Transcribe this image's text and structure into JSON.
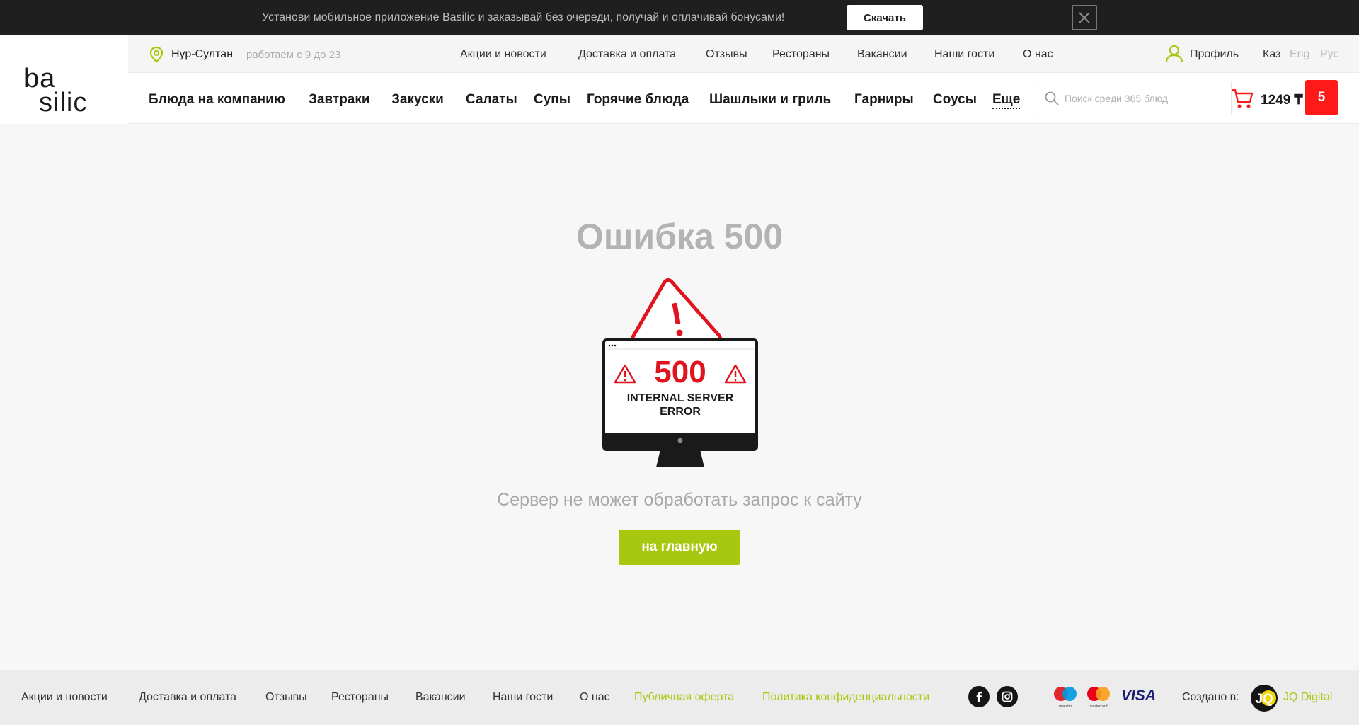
{
  "banner": {
    "text": "Установи мобильное приложение Basilic и заказывай без очереди, получай и оплачивай бонусами!",
    "download": "Скачать"
  },
  "logo": {
    "line1": "ba",
    "line2": "silic"
  },
  "topbar": {
    "city": "Нур-Султан",
    "hours": "работаем с 9 до 23",
    "nav": [
      "Акции и новости",
      "Доставка и оплата",
      "Отзывы",
      "Рестораны",
      "Вакансии",
      "Наши гости",
      "О нас"
    ],
    "profile": "Профиль",
    "langs": [
      "Каз",
      "Eng",
      "Рус"
    ]
  },
  "categories": [
    "Блюда на компанию",
    "Завтраки",
    "Закуски",
    "Салаты",
    "Супы",
    "Горячие блюда",
    "Шашлыки и гриль",
    "Гарниры",
    "Соусы",
    "Еще"
  ],
  "search": {
    "placeholder": "Поиск среди 365 блюд"
  },
  "cart": {
    "total": "1249 ₸",
    "count": "5"
  },
  "error": {
    "title": "Ошибка 500",
    "code": "500",
    "screen_line1": "INTERNAL SERVER",
    "screen_line2": "ERROR",
    "message": "Сервер не может обработать запрос к сайту",
    "button": "на главную"
  },
  "footer": {
    "nav": [
      "Акции и новости",
      "Доставка и оплата",
      "Отзывы",
      "Рестораны",
      "Вакансии",
      "Наши гости",
      "О нас"
    ],
    "offer": "Публичная оферта",
    "privacy": "Политика конфиденциальности",
    "maestro_label": "maestro",
    "mastercard_label": "mastercard",
    "visa": "VISA",
    "made_by": "Создано в:",
    "jq_mark": "JQ",
    "agency": "JQ Digital"
  },
  "colors": {
    "accent": "#a8c80f",
    "cart_badge": "#ff1a1a",
    "banner_bg": "#1f1f1f",
    "error_red": "#e0141e"
  },
  "icons": {
    "city": "map-pin-icon",
    "profile": "user-icon",
    "search": "search-icon",
    "cart": "cart-icon",
    "close": "close-icon",
    "facebook": "facebook-icon",
    "instagram": "instagram-icon"
  }
}
